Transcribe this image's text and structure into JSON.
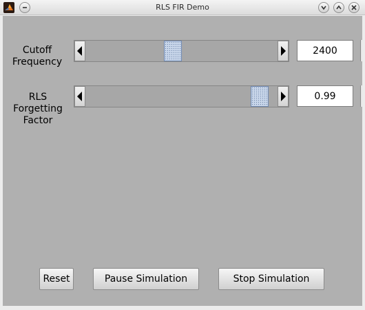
{
  "window": {
    "title": "RLS FIR Demo"
  },
  "controls": [
    {
      "label": "Cutoff Frequency",
      "value": "2400",
      "slider_position": 0.45
    },
    {
      "label": "RLS Forgetting Factor",
      "value": "0.99",
      "slider_position": 0.95
    }
  ],
  "buttons": {
    "reset": "Reset",
    "pause": "Pause Simulation",
    "stop": "Stop Simulation"
  }
}
